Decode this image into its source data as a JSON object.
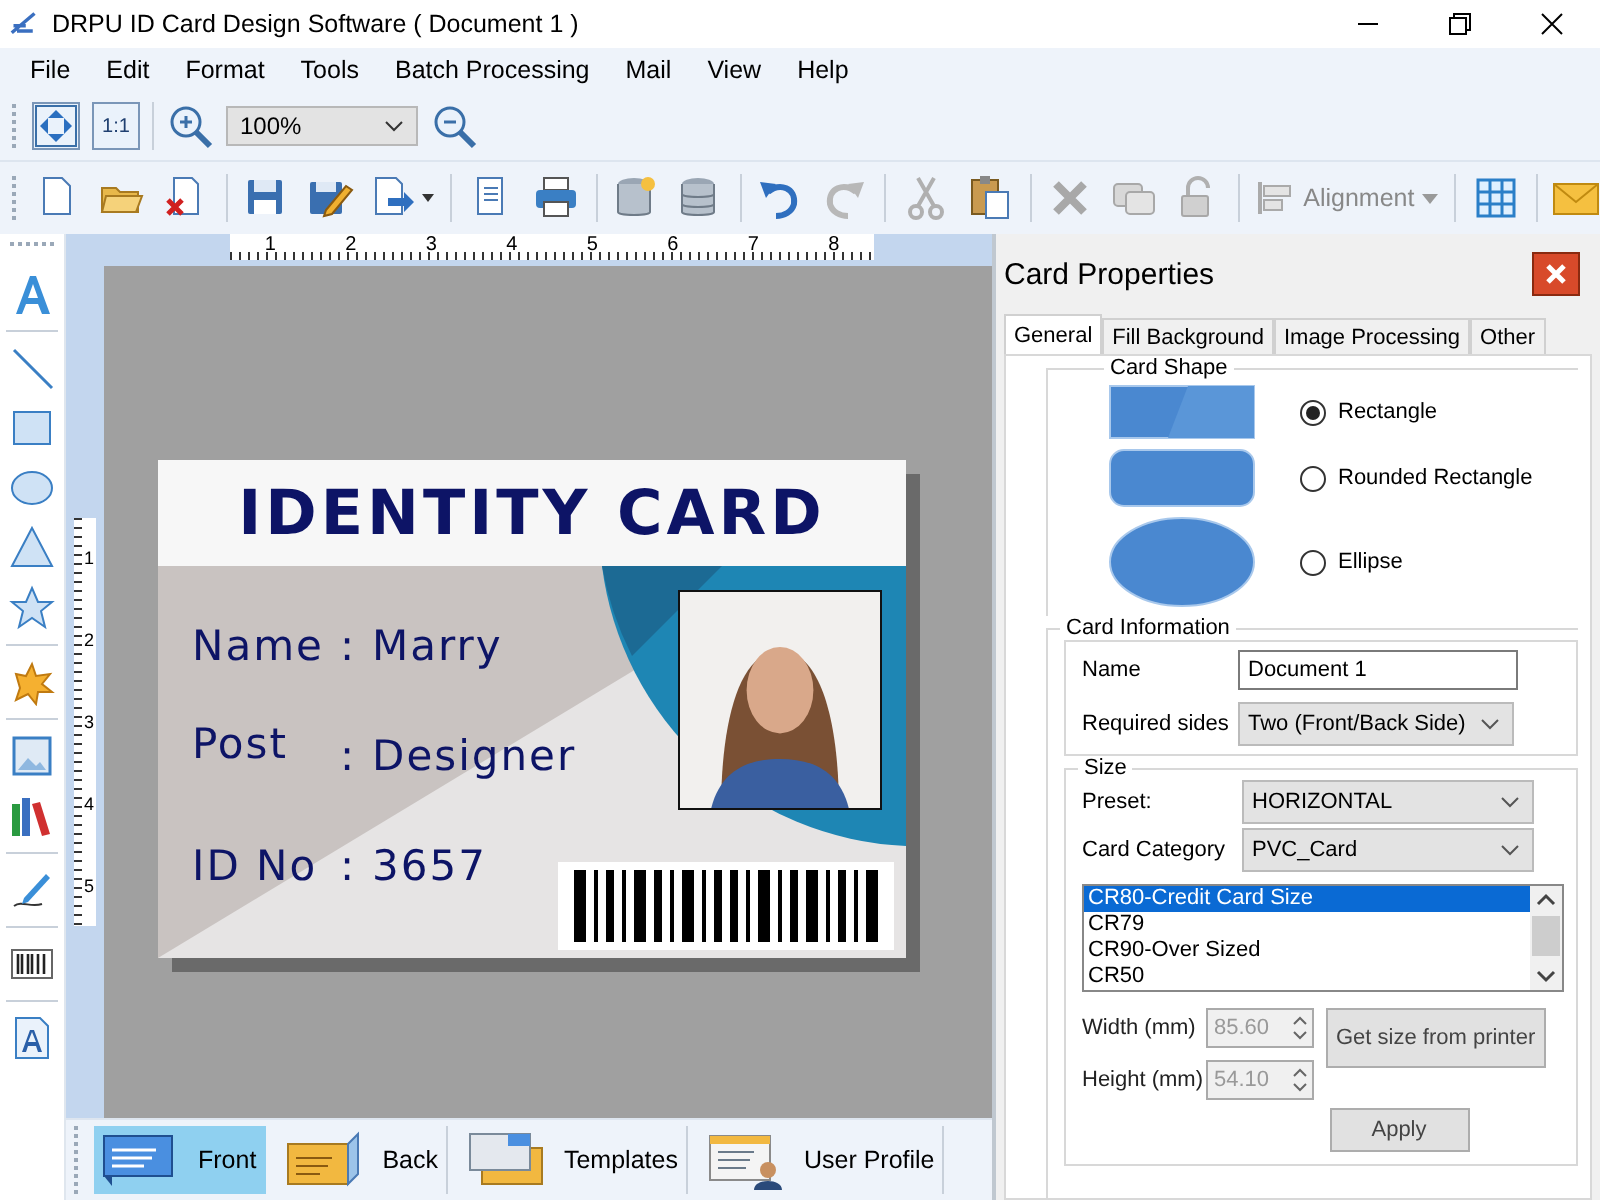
{
  "window": {
    "title": "DRPU ID Card Design Software ( Document 1 )"
  },
  "menu": [
    "File",
    "Edit",
    "Format",
    "Tools",
    "Batch Processing",
    "Mail",
    "View",
    "Help"
  ],
  "toolbar": {
    "actual_size": "1:1",
    "zoom": "100%",
    "alignment": "Alignment"
  },
  "rulers": {
    "horizontal": [
      "1",
      "2",
      "3",
      "4",
      "5",
      "6",
      "7",
      "8"
    ],
    "vertical": [
      "1",
      "2",
      "3",
      "4",
      "5"
    ]
  },
  "card": {
    "title": "IDENTITY CARD",
    "fields": [
      {
        "label": "Name",
        "separator": ":",
        "value": "Marry"
      },
      {
        "label": "Post",
        "separator": ":",
        "value": "Designer"
      },
      {
        "label": "ID No",
        "separator": ":",
        "value": "3657"
      }
    ]
  },
  "bottom_tabs": [
    {
      "label": "Front",
      "kind": "front",
      "selected": true
    },
    {
      "label": "Back",
      "kind": "back",
      "selected": false
    },
    {
      "label": "Templates",
      "kind": "templates",
      "selected": false
    },
    {
      "label": "User Profile",
      "kind": "profile",
      "selected": false
    }
  ],
  "properties": {
    "title": "Card Properties",
    "tabs": [
      {
        "label": "General",
        "selected": true
      },
      {
        "label": "Fill Background",
        "selected": false
      },
      {
        "label": "Image Processing",
        "selected": false
      },
      {
        "label": "Other",
        "selected": false
      }
    ],
    "card_shape": {
      "legend": "Card Shape",
      "options": [
        {
          "label": "Rectangle",
          "kind": "rectangle",
          "selected": true
        },
        {
          "label": "Rounded Rectangle",
          "kind": "rounded",
          "selected": false
        },
        {
          "label": "Ellipse",
          "kind": "ellipse",
          "selected": false
        }
      ]
    },
    "card_information": {
      "legend": "Card Information",
      "name_label": "Name",
      "name_value": "Document 1",
      "sides_label": "Required sides",
      "sides_value": "Two (Front/Back Side)"
    },
    "size": {
      "legend": "Size",
      "preset_label": "Preset:",
      "preset_value": "HORIZONTAL",
      "category_label": "Card Category",
      "category_value": "PVC_Card",
      "sizes": [
        {
          "label": "CR80-Credit Card Size",
          "selected": true
        },
        {
          "label": "CR79",
          "selected": false
        },
        {
          "label": "CR90-Over Sized",
          "selected": false
        },
        {
          "label": "CR50",
          "selected": false
        }
      ],
      "width": {
        "label": "Width (mm)",
        "value": "85.60",
        "disabled": true
      },
      "height": {
        "label": "Height (mm)",
        "value": "54.10",
        "disabled": true
      },
      "printer_button": "Get size from printer",
      "apply_button": "Apply"
    }
  }
}
